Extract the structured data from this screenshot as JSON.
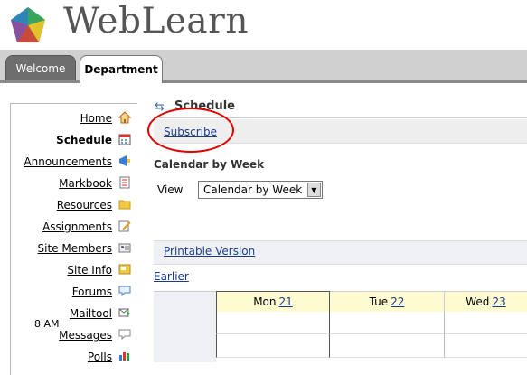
{
  "app": {
    "brand": "WebLearn"
  },
  "tabs": [
    {
      "label": "Welcome"
    },
    {
      "label": "Department"
    }
  ],
  "nav": [
    {
      "label": "Home",
      "icon": "home-icon"
    },
    {
      "label": "Schedule",
      "icon": "calendar-icon"
    },
    {
      "label": "Announcements",
      "icon": "megaphone-icon"
    },
    {
      "label": "Markbook",
      "icon": "markbook-icon"
    },
    {
      "label": "Resources",
      "icon": "folder-icon"
    },
    {
      "label": "Assignments",
      "icon": "assignment-icon"
    },
    {
      "label": "Site Members",
      "icon": "members-icon"
    },
    {
      "label": "Site Info",
      "icon": "site-info-icon"
    },
    {
      "label": "Forums",
      "icon": "forums-icon"
    },
    {
      "label": "Mailtool",
      "icon": "mail-icon"
    },
    {
      "label": "Messages",
      "icon": "messages-icon"
    },
    {
      "label": "Polls",
      "icon": "polls-icon"
    }
  ],
  "main": {
    "title": "Schedule",
    "subscribe": "Subscribe",
    "calendar_heading": "Calendar by Week",
    "view_label": "View",
    "view_selected": "Calendar by Week",
    "printable": "Printable Version",
    "earlier": "Earlier"
  },
  "calendar": {
    "days": [
      {
        "name": "Mon",
        "date": "21"
      },
      {
        "name": "Tue",
        "date": "22"
      },
      {
        "name": "Wed",
        "date": "23"
      }
    ],
    "times": [
      "8 AM"
    ]
  },
  "colors": {
    "link": "#1a3c8f",
    "highlight_circle": "#e00000",
    "day_header": "#fffbd0"
  }
}
